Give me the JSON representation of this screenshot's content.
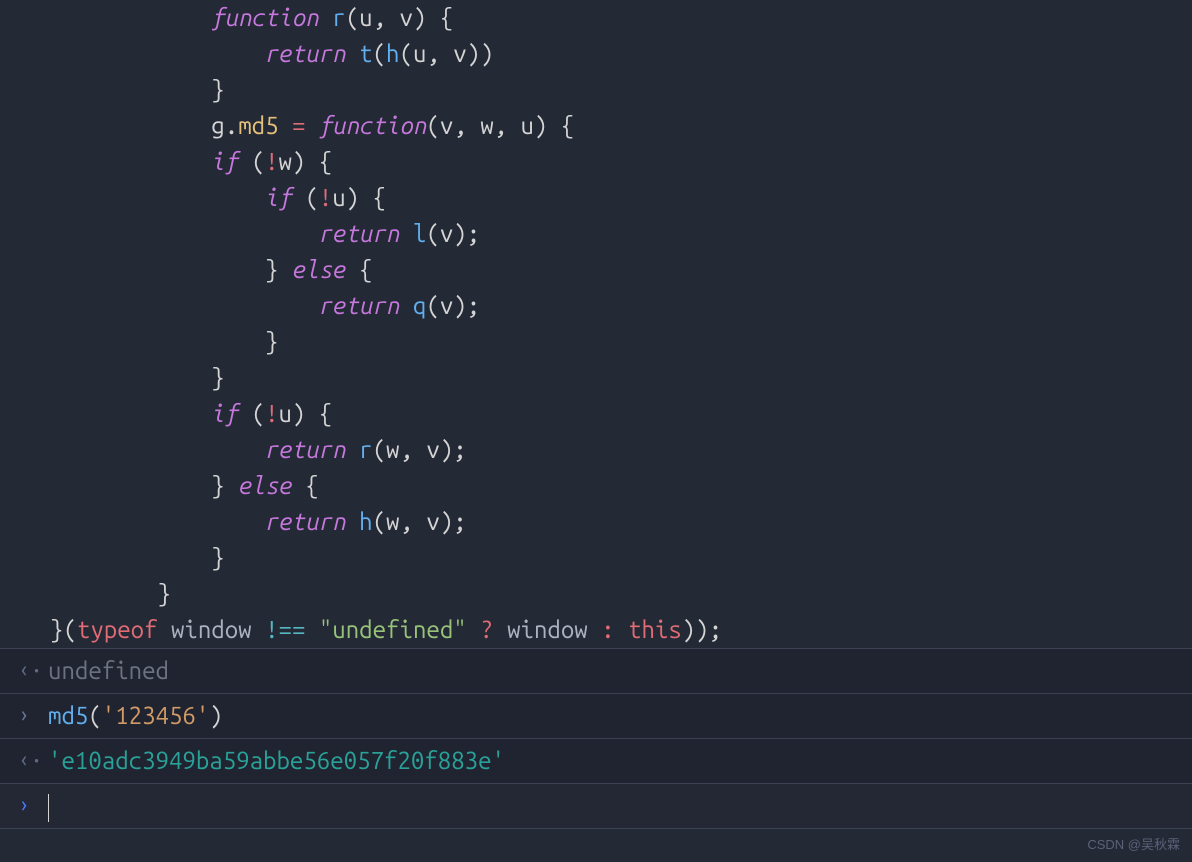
{
  "code": {
    "lines": [
      {
        "indent": 12,
        "tokens": [
          {
            "t": "function",
            "c": "keyword"
          },
          {
            "t": " ",
            "c": "def"
          },
          {
            "t": "r",
            "c": "fnname"
          },
          {
            "t": "(",
            "c": "paren"
          },
          {
            "t": "u",
            "c": "param"
          },
          {
            "t": ", ",
            "c": "punc"
          },
          {
            "t": "v",
            "c": "param"
          },
          {
            "t": ") ",
            "c": "paren"
          },
          {
            "t": "{",
            "c": "brace"
          }
        ]
      },
      {
        "indent": 16,
        "tokens": [
          {
            "t": "return",
            "c": "keyword"
          },
          {
            "t": " ",
            "c": "def"
          },
          {
            "t": "t",
            "c": "fnname"
          },
          {
            "t": "(",
            "c": "paren"
          },
          {
            "t": "h",
            "c": "fnname"
          },
          {
            "t": "(",
            "c": "paren"
          },
          {
            "t": "u",
            "c": "var"
          },
          {
            "t": ", ",
            "c": "punc"
          },
          {
            "t": "v",
            "c": "var"
          },
          {
            "t": "))",
            "c": "paren"
          }
        ]
      },
      {
        "indent": 12,
        "tokens": [
          {
            "t": "}",
            "c": "brace"
          }
        ]
      },
      {
        "indent": 0,
        "tokens": [
          {
            "t": "",
            "c": "def"
          }
        ]
      },
      {
        "indent": 12,
        "tokens": [
          {
            "t": "g",
            "c": "var"
          },
          {
            "t": ".",
            "c": "punc"
          },
          {
            "t": "md5",
            "c": "md5"
          },
          {
            "t": " ",
            "c": "def"
          },
          {
            "t": "=",
            "c": "operator"
          },
          {
            "t": " ",
            "c": "def"
          },
          {
            "t": "function",
            "c": "keyword"
          },
          {
            "t": "(",
            "c": "paren"
          },
          {
            "t": "v",
            "c": "param"
          },
          {
            "t": ", ",
            "c": "punc"
          },
          {
            "t": "w",
            "c": "param"
          },
          {
            "t": ", ",
            "c": "punc"
          },
          {
            "t": "u",
            "c": "param"
          },
          {
            "t": ") ",
            "c": "paren"
          },
          {
            "t": "{",
            "c": "brace"
          }
        ]
      },
      {
        "indent": 12,
        "tokens": [
          {
            "t": "if",
            "c": "keyword"
          },
          {
            "t": " (",
            "c": "paren"
          },
          {
            "t": "!",
            "c": "operator"
          },
          {
            "t": "w",
            "c": "var"
          },
          {
            "t": ") ",
            "c": "paren"
          },
          {
            "t": "{",
            "c": "brace"
          }
        ]
      },
      {
        "indent": 16,
        "tokens": [
          {
            "t": "if",
            "c": "keyword"
          },
          {
            "t": " (",
            "c": "paren"
          },
          {
            "t": "!",
            "c": "operator"
          },
          {
            "t": "u",
            "c": "var"
          },
          {
            "t": ") ",
            "c": "paren"
          },
          {
            "t": "{",
            "c": "brace"
          }
        ]
      },
      {
        "indent": 20,
        "tokens": [
          {
            "t": "return",
            "c": "keyword"
          },
          {
            "t": " ",
            "c": "def"
          },
          {
            "t": "l",
            "c": "fnname"
          },
          {
            "t": "(",
            "c": "paren"
          },
          {
            "t": "v",
            "c": "var"
          },
          {
            "t": ")",
            "c": "paren"
          },
          {
            "t": ";",
            "c": "punc"
          }
        ]
      },
      {
        "indent": 16,
        "tokens": [
          {
            "t": "}",
            "c": "brace"
          },
          {
            "t": " ",
            "c": "def"
          },
          {
            "t": "else",
            "c": "keyword"
          },
          {
            "t": " ",
            "c": "def"
          },
          {
            "t": "{",
            "c": "brace"
          }
        ]
      },
      {
        "indent": 20,
        "tokens": [
          {
            "t": "return",
            "c": "keyword"
          },
          {
            "t": " ",
            "c": "def"
          },
          {
            "t": "q",
            "c": "fnname"
          },
          {
            "t": "(",
            "c": "paren"
          },
          {
            "t": "v",
            "c": "var"
          },
          {
            "t": ")",
            "c": "paren"
          },
          {
            "t": ";",
            "c": "punc"
          }
        ]
      },
      {
        "indent": 16,
        "tokens": [
          {
            "t": "}",
            "c": "brace"
          }
        ]
      },
      {
        "indent": 12,
        "tokens": [
          {
            "t": "}",
            "c": "brace"
          }
        ]
      },
      {
        "indent": 12,
        "tokens": [
          {
            "t": "if",
            "c": "keyword"
          },
          {
            "t": " (",
            "c": "paren"
          },
          {
            "t": "!",
            "c": "operator"
          },
          {
            "t": "u",
            "c": "var"
          },
          {
            "t": ") ",
            "c": "paren"
          },
          {
            "t": "{",
            "c": "brace"
          }
        ]
      },
      {
        "indent": 16,
        "tokens": [
          {
            "t": "return",
            "c": "keyword"
          },
          {
            "t": " ",
            "c": "def"
          },
          {
            "t": "r",
            "c": "fnname"
          },
          {
            "t": "(",
            "c": "paren"
          },
          {
            "t": "w",
            "c": "var"
          },
          {
            "t": ", ",
            "c": "punc"
          },
          {
            "t": "v",
            "c": "var"
          },
          {
            "t": ")",
            "c": "paren"
          },
          {
            "t": ";",
            "c": "punc"
          }
        ]
      },
      {
        "indent": 12,
        "tokens": [
          {
            "t": "}",
            "c": "brace"
          },
          {
            "t": " ",
            "c": "def"
          },
          {
            "t": "else",
            "c": "keyword"
          },
          {
            "t": " ",
            "c": "def"
          },
          {
            "t": "{",
            "c": "brace"
          }
        ]
      },
      {
        "indent": 16,
        "tokens": [
          {
            "t": "return",
            "c": "keyword"
          },
          {
            "t": " ",
            "c": "def"
          },
          {
            "t": "h",
            "c": "fnname"
          },
          {
            "t": "(",
            "c": "paren"
          },
          {
            "t": "w",
            "c": "var"
          },
          {
            "t": ", ",
            "c": "punc"
          },
          {
            "t": "v",
            "c": "var"
          },
          {
            "t": ")",
            "c": "paren"
          },
          {
            "t": ";",
            "c": "punc"
          }
        ]
      },
      {
        "indent": 12,
        "tokens": [
          {
            "t": "}",
            "c": "brace"
          }
        ]
      },
      {
        "indent": 8,
        "tokens": [
          {
            "t": "}",
            "c": "brace"
          }
        ]
      },
      {
        "indent": 0,
        "tokens": [
          {
            "t": "}(",
            "c": "brace"
          },
          {
            "t": "typeof",
            "c": "typeof"
          },
          {
            "t": " ",
            "c": "def"
          },
          {
            "t": "window",
            "c": "window"
          },
          {
            "t": " ",
            "c": "def"
          },
          {
            "t": "!==",
            "c": "neq"
          },
          {
            "t": " ",
            "c": "def"
          },
          {
            "t": "\"undefined\"",
            "c": "string"
          },
          {
            "t": " ",
            "c": "def"
          },
          {
            "t": "?",
            "c": "operator"
          },
          {
            "t": " ",
            "c": "def"
          },
          {
            "t": "window",
            "c": "window"
          },
          {
            "t": " ",
            "c": "def"
          },
          {
            "t": ":",
            "c": "operator"
          },
          {
            "t": " ",
            "c": "def"
          },
          {
            "t": "this",
            "c": "this"
          },
          {
            "t": "));",
            "c": "paren"
          }
        ]
      }
    ]
  },
  "console": {
    "lines": [
      {
        "type": "out",
        "tokens": [
          {
            "t": "undefined",
            "c": "undefined"
          }
        ]
      },
      {
        "type": "in",
        "tokens": [
          {
            "t": "md5",
            "c": "fnname"
          },
          {
            "t": "(",
            "c": "paren"
          },
          {
            "t": "'123456'",
            "c": "string2"
          },
          {
            "t": ")",
            "c": "paren"
          }
        ]
      },
      {
        "type": "out",
        "tokens": [
          {
            "t": "'e10adc3949ba59abbe56e057f20f883e'",
            "c": "result"
          }
        ]
      },
      {
        "type": "prompt",
        "tokens": []
      }
    ]
  },
  "watermark": "CSDN @吴秋霖"
}
